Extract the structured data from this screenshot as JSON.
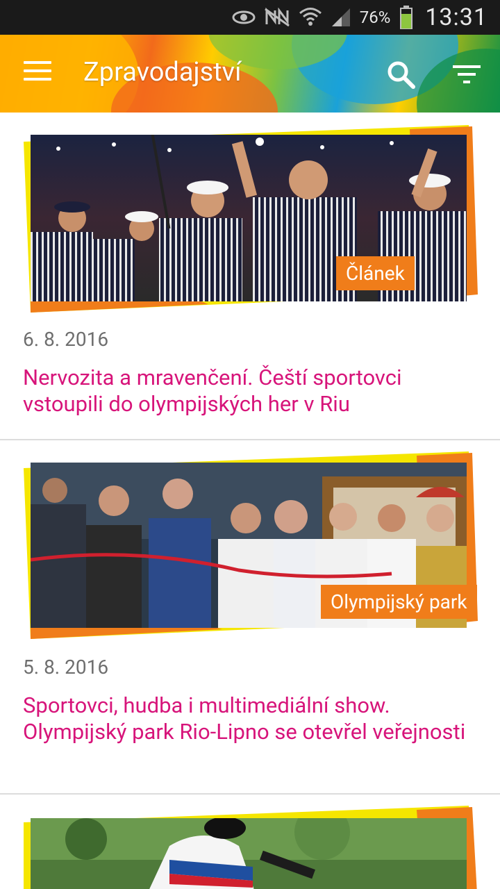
{
  "status_bar": {
    "battery_percent": "76%",
    "time": "13:31",
    "icons": [
      "eye-icon",
      "nfc-off-icon",
      "wifi-icon",
      "cell-signal-icon",
      "battery-icon"
    ]
  },
  "app_bar": {
    "title": "Zpravodajství",
    "icons": [
      "menu-icon",
      "search-icon",
      "filter-icon"
    ]
  },
  "articles": [
    {
      "badge": "Článek",
      "date": "6. 8. 2016",
      "headline": "Nervozita a mravenčení. Čeští sportovci vstoupili do olympijských her v Riu",
      "image": "czech-athletes-opening-ceremony-photo"
    },
    {
      "badge": "Olympijský park",
      "date": "5. 8. 2016",
      "headline": "Sportovci, hudba i multimediální show. Olympijský park Rio-Lipno se otevřel veřejnosti",
      "image": "ribbon-cutting-olympic-park-photo"
    },
    {
      "badge": "",
      "date": "",
      "headline": "",
      "image": "cyclist-photo"
    }
  ],
  "colors": {
    "headline": "#d7147a",
    "badge": "#f07d1a",
    "frame_yellow": "#f5e600",
    "frame_orange": "#f07d1a",
    "status_bar": "#1a1a1a"
  }
}
